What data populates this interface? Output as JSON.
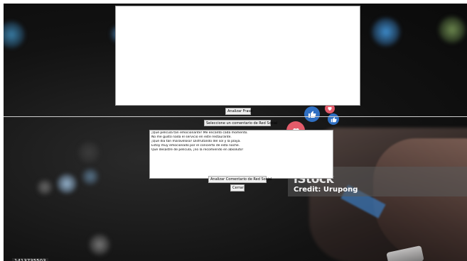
{
  "phrase_panel": {
    "analyze_button_label": "Analizar Frase"
  },
  "social_panel": {
    "select_label": "Seleccione un comentario de Red Social",
    "comments": [
      "¡Qué película tan emocionante! Me encantó cada momento.",
      "No me gustó nada el servicio en este restaurante.",
      "¡Qué día tan maravilloso! Disfrutando del sol y la playa.",
      "Estoy muy emocionado por el concierto de esta noche.",
      "Qué desastre de película, ¡no la recomiendo en absoluto!"
    ],
    "analyze_button_label": "Analizar Comentario de Red Social",
    "close_button_label": "Cerrar"
  },
  "background": {
    "watermark_brand": "iStock",
    "watermark_credit": "Credit: Urupong",
    "image_id": "1413735503"
  },
  "colors": {
    "like_blue": "#2f6fc2",
    "heart_pink": "#e35b6a"
  },
  "icons": {
    "like": "thumbs-up-icon",
    "heart": "heart-icon"
  }
}
